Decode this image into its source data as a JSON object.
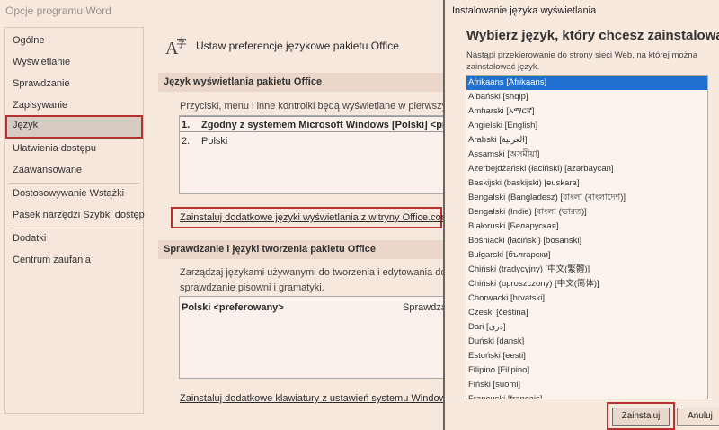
{
  "window": {
    "title": "Opcje programu Word"
  },
  "sidebar": {
    "items": [
      {
        "label": "Ogólne"
      },
      {
        "label": "Wyświetlanie"
      },
      {
        "label": "Sprawdzanie"
      },
      {
        "label": "Zapisywanie"
      },
      {
        "label": "Język",
        "active": true
      },
      {
        "label": "Ułatwienia dostępu"
      },
      {
        "label": "Zaawansowane"
      },
      {
        "label": "Dostosowywanie Wstążki"
      },
      {
        "label": "Pasek narzędzi Szybki dostęp"
      },
      {
        "label": "Dodatki"
      },
      {
        "label": "Centrum zaufania"
      }
    ]
  },
  "main": {
    "heading": "Ustaw preferencje językowe pakietu Office",
    "display_section": {
      "title": "Język wyświetlania pakietu Office",
      "description": "Przyciski, menu i inne kontrolki będą wyświetlane w pierwszym",
      "languages": [
        {
          "num": "1.",
          "label": "Zgodny z systemem Microsoft Windows [Polski] <prefer"
        },
        {
          "num": "2.",
          "label": "Polski"
        }
      ],
      "install_link": "Zainstaluj dodatkowe języki wyświetlania z witryny Office.com"
    },
    "authoring_section": {
      "title": "Sprawdzanie i języki tworzenia pakietu Office",
      "description_line1": "Zarządzaj językami używanymi do tworzenia i edytowania doku",
      "description_line2": "sprawdzanie pisowni i gramatyki.",
      "table_language": "Polski <preferowany>",
      "table_status": "Sprawdza",
      "keyboard_link": "Zainstaluj dodatkowe klawiatury z ustawień systemu Windows"
    }
  },
  "dialog": {
    "title": "Instalowanie języka wyświetlania",
    "heading": "Wybierz język, który chcesz zainstalować.",
    "description": "Nastąpi przekierowanie do strony sieci Web, na której można zainstalować język.",
    "languages": [
      {
        "label": "Afrikaans [Afrikaans]",
        "selected": true
      },
      {
        "label": "Albański [shqip]"
      },
      {
        "label": "Amharski [አማርኛ]"
      },
      {
        "label": "Angielski [English]"
      },
      {
        "label": "Arabski [العربية]"
      },
      {
        "label": "Assamski [অসমীয়া]"
      },
      {
        "label": "Azerbejdżański (łaciński) [azərbaycan]"
      },
      {
        "label": "Baskijski (baskijski) [euskara]"
      },
      {
        "label": "Bengalski (Bangladesz) [বাংলা (বাংলাদেশ)]"
      },
      {
        "label": "Bengalski (Indie) [বাংলা (ভারত)]"
      },
      {
        "label": "Białoruski [Беларуская]"
      },
      {
        "label": "Bośniacki (łaciński) [bosanski]"
      },
      {
        "label": "Bułgarski [български]"
      },
      {
        "label": "Chiński (tradycyjny) [中文(繁體)]"
      },
      {
        "label": "Chiński (uproszczony) [中文(简体)]"
      },
      {
        "label": "Chorwacki [hrvatski]"
      },
      {
        "label": "Czeski [čeština]"
      },
      {
        "label": "Dari [دری]"
      },
      {
        "label": "Duński [dansk]"
      },
      {
        "label": "Estoński [eesti]"
      },
      {
        "label": "Filipino [Filipino]"
      },
      {
        "label": "Fiński [suomi]"
      },
      {
        "label": "Francuski [français]"
      }
    ],
    "install_button": "Zainstaluj",
    "cancel_button": "Anuluj"
  }
}
